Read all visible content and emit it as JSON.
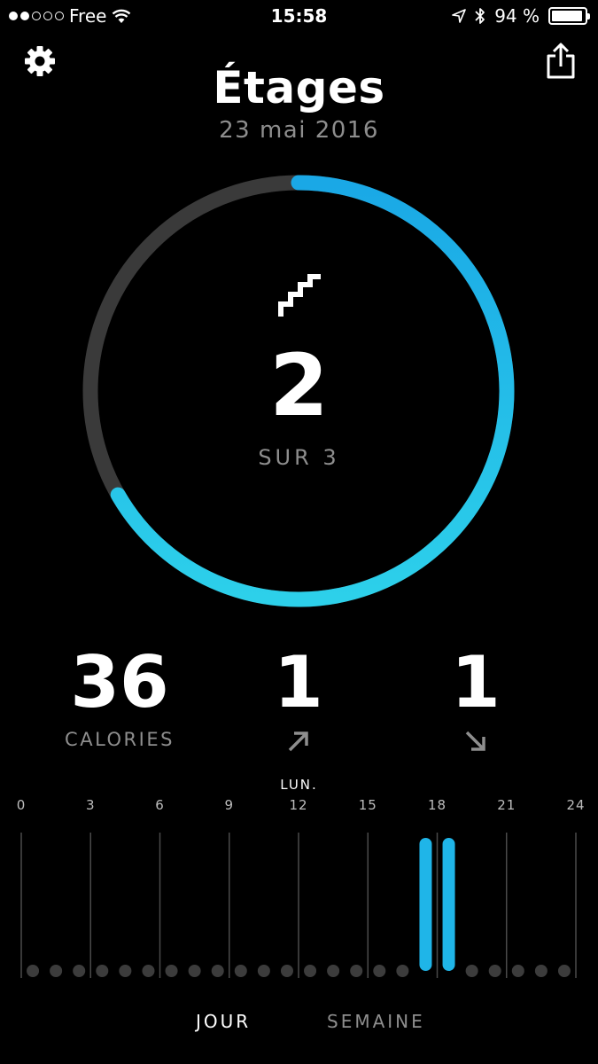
{
  "status_bar": {
    "carrier": "Free",
    "signal_dots": [
      true,
      true,
      false,
      false,
      false
    ],
    "time": "15:58",
    "battery_text": "94 %",
    "battery_level": 0.94
  },
  "header": {
    "settings_icon": "gear-icon",
    "share_icon": "share-icon",
    "title": "Étages",
    "date": "23 mai 2016"
  },
  "ring": {
    "icon": "stairs-icon",
    "value": "2",
    "goal_text": "SUR 3",
    "progress": 0.667,
    "track_color": "#3a3a3a",
    "progress_color": "#1fb5e8"
  },
  "stats": [
    {
      "value": "36",
      "label": "CALORIES",
      "icon": null
    },
    {
      "value": "1",
      "label": "",
      "icon": "arrow-up-right-icon"
    },
    {
      "value": "1",
      "label": "",
      "icon": "arrow-down-right-icon"
    }
  ],
  "day_chart": {
    "day_label": "LUN.",
    "tick_labels": [
      "0",
      "3",
      "6",
      "9",
      "12",
      "15",
      "18",
      "21",
      "24"
    ],
    "values": [
      0,
      0,
      0,
      0,
      0,
      0,
      0,
      0,
      0,
      0,
      0,
      0,
      0,
      0,
      0,
      0,
      0,
      1,
      1,
      0,
      0,
      0,
      0,
      0
    ],
    "bar_color": "#1fb5e8"
  },
  "chart_data": {
    "type": "bar",
    "categories": [
      "0",
      "1",
      "2",
      "3",
      "4",
      "5",
      "6",
      "7",
      "8",
      "9",
      "10",
      "11",
      "12",
      "13",
      "14",
      "15",
      "16",
      "17",
      "18",
      "19",
      "20",
      "21",
      "22",
      "23"
    ],
    "values": [
      0,
      0,
      0,
      0,
      0,
      0,
      0,
      0,
      0,
      0,
      0,
      0,
      0,
      0,
      0,
      0,
      0,
      1,
      1,
      0,
      0,
      0,
      0,
      0
    ],
    "title": "LUN.",
    "xlabel": "",
    "ylabel": "",
    "xticks": [
      "0",
      "3",
      "6",
      "9",
      "12",
      "15",
      "18",
      "21",
      "24"
    ],
    "grid": true
  },
  "tabs": [
    {
      "label": "JOUR",
      "active": true
    },
    {
      "label": "SEMAINE",
      "active": false
    }
  ]
}
